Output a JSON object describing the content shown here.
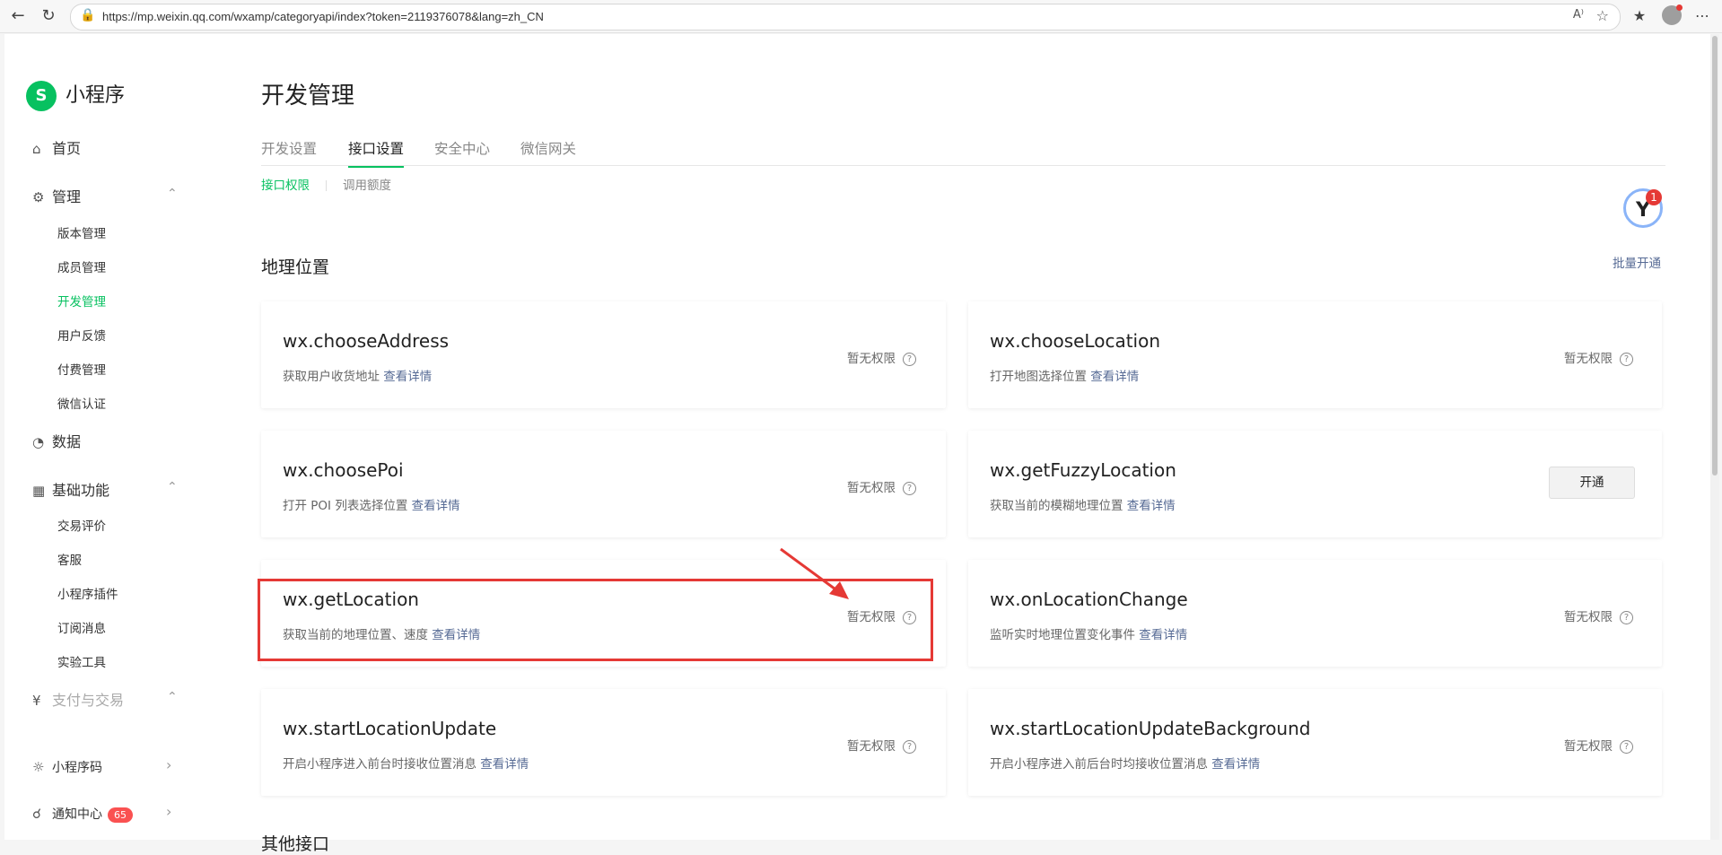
{
  "browser": {
    "url": "https://mp.weixin.qq.com/wxamp/categoryapi/index?token=2119376078&lang=zh_CN"
  },
  "sidebar": {
    "brand": "小程序",
    "items": [
      {
        "label": "首页"
      },
      {
        "label": "管理"
      },
      {
        "label": "数据"
      },
      {
        "label": "基础功能"
      },
      {
        "label": "支付与交易"
      }
    ],
    "manage_sub": [
      "版本管理",
      "成员管理",
      "开发管理",
      "用户反馈",
      "付费管理",
      "微信认证"
    ],
    "basic_sub": [
      "交易评价",
      "客服",
      "小程序插件",
      "订阅消息",
      "实验工具"
    ],
    "bottom": {
      "qrcode": "小程序码",
      "notify": "通知中心",
      "notify_count": "65"
    }
  },
  "main": {
    "title": "开发管理",
    "tabs": [
      "开发设置",
      "接口设置",
      "安全中心",
      "微信网关"
    ],
    "subtabs": [
      "接口权限",
      "调用额度"
    ],
    "section_title": "地理位置",
    "batch_link": "批量开通",
    "float_badge": "1",
    "next_section": "其他接口"
  },
  "apis": [
    {
      "name": "wx.chooseAddress",
      "desc": "获取用户收货地址",
      "link": "查看详情",
      "status": "暂无权限"
    },
    {
      "name": "wx.chooseLocation",
      "desc": "打开地图选择位置",
      "link": "查看详情",
      "status": "暂无权限"
    },
    {
      "name": "wx.choosePoi",
      "desc": "打开 POI 列表选择位置",
      "link": "查看详情",
      "status": "暂无权限"
    },
    {
      "name": "wx.getFuzzyLocation",
      "desc": "获取当前的模糊地理位置",
      "link": "查看详情",
      "button": "开通"
    },
    {
      "name": "wx.getLocation",
      "desc": "获取当前的地理位置、速度",
      "link": "查看详情",
      "status": "暂无权限"
    },
    {
      "name": "wx.onLocationChange",
      "desc": "监听实时地理位置变化事件",
      "link": "查看详情",
      "status": "暂无权限"
    },
    {
      "name": "wx.startLocationUpdate",
      "desc": "开启小程序进入前台时接收位置消息",
      "link": "查看详情",
      "status": "暂无权限"
    },
    {
      "name": "wx.startLocationUpdateBackground",
      "desc": "开启小程序进入前后台时均接收位置消息",
      "link": "查看详情",
      "status": "暂无权限"
    }
  ],
  "colors": {
    "accent": "#07c160",
    "link": "#576b95",
    "highlight": "#e53935"
  }
}
